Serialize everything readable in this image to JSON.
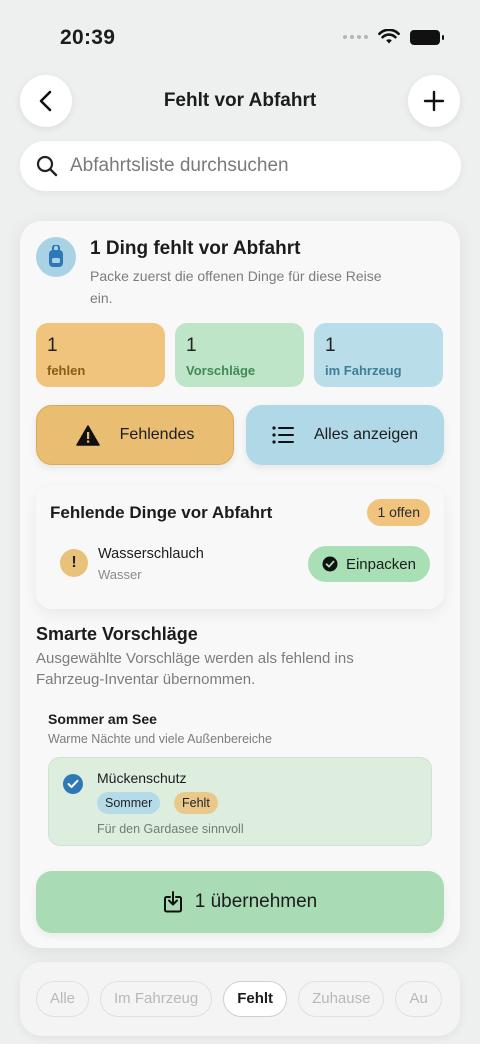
{
  "status_bar": {
    "time": "20:39"
  },
  "nav": {
    "title": "Fehlt vor Abfahrt"
  },
  "search": {
    "placeholder": "Abfahrtsliste durchsuchen"
  },
  "summary": {
    "title": "1 Ding fehlt vor Abfahrt",
    "subtitle": "Packe zuerst die offenen Dinge für diese Reise ein.",
    "icon": "backpack-icon"
  },
  "stats": [
    {
      "value": "1",
      "label": "fehlen"
    },
    {
      "value": "1",
      "label": "Vorschläge"
    },
    {
      "value": "1",
      "label": "im Fahrzeug"
    }
  ],
  "actions": {
    "missing_label": "Fehlendes",
    "all_label": "Alles anzeigen"
  },
  "missing_section": {
    "title": "Fehlende Dinge vor Abfahrt",
    "badge": "1 offen",
    "items": [
      {
        "name": "Wasserschlauch",
        "category": "Wasser",
        "action": "Einpacken"
      }
    ]
  },
  "smart": {
    "title": "Smarte Vorschläge",
    "subtitle": "Ausgewählte Vorschläge werden als fehlend ins Fahrzeug-Inventar übernommen.",
    "group_title": "Sommer am See",
    "group_subtitle": "Warme Nächte und viele Außenbereiche",
    "suggestion": {
      "name": "Mückenschutz",
      "tags": [
        "Sommer",
        "Fehlt"
      ],
      "note": "Für den Gardasee sinnvoll"
    },
    "apply_label": "1 übernehmen"
  },
  "filters": [
    "Alle",
    "Im Fahrzeug",
    "Fehlt",
    "Zuhause",
    "Au"
  ],
  "colors": {
    "orange": "#f0c47d",
    "green": "#bfe5c8",
    "blue": "#b9dde9",
    "check_blue": "#2e78b7"
  }
}
